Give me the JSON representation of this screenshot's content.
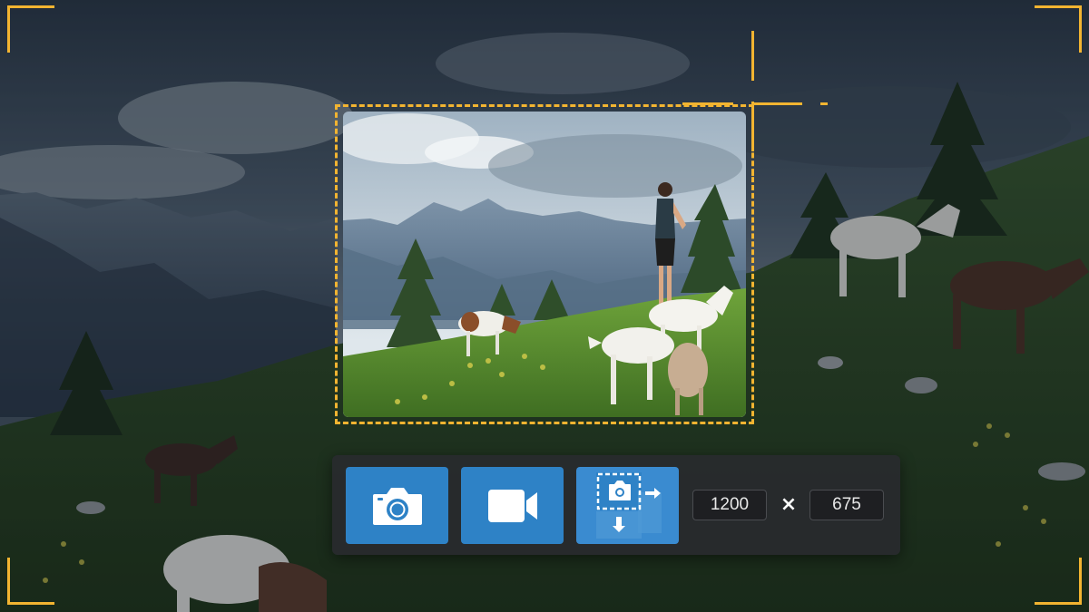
{
  "capture": {
    "width_value": "1200",
    "height_value": "675",
    "multiply_sign": "×"
  },
  "toolbar": {
    "buttons": [
      {
        "id": "screenshot",
        "icon": "camera-icon"
      },
      {
        "id": "record-video",
        "icon": "video-camera-icon"
      },
      {
        "id": "capture-region",
        "icon": "region-capture-icon"
      }
    ]
  },
  "colors": {
    "selection_accent": "#f2b431",
    "button_blue": "#2e82c6",
    "toolbar_bg": "#28292e"
  }
}
